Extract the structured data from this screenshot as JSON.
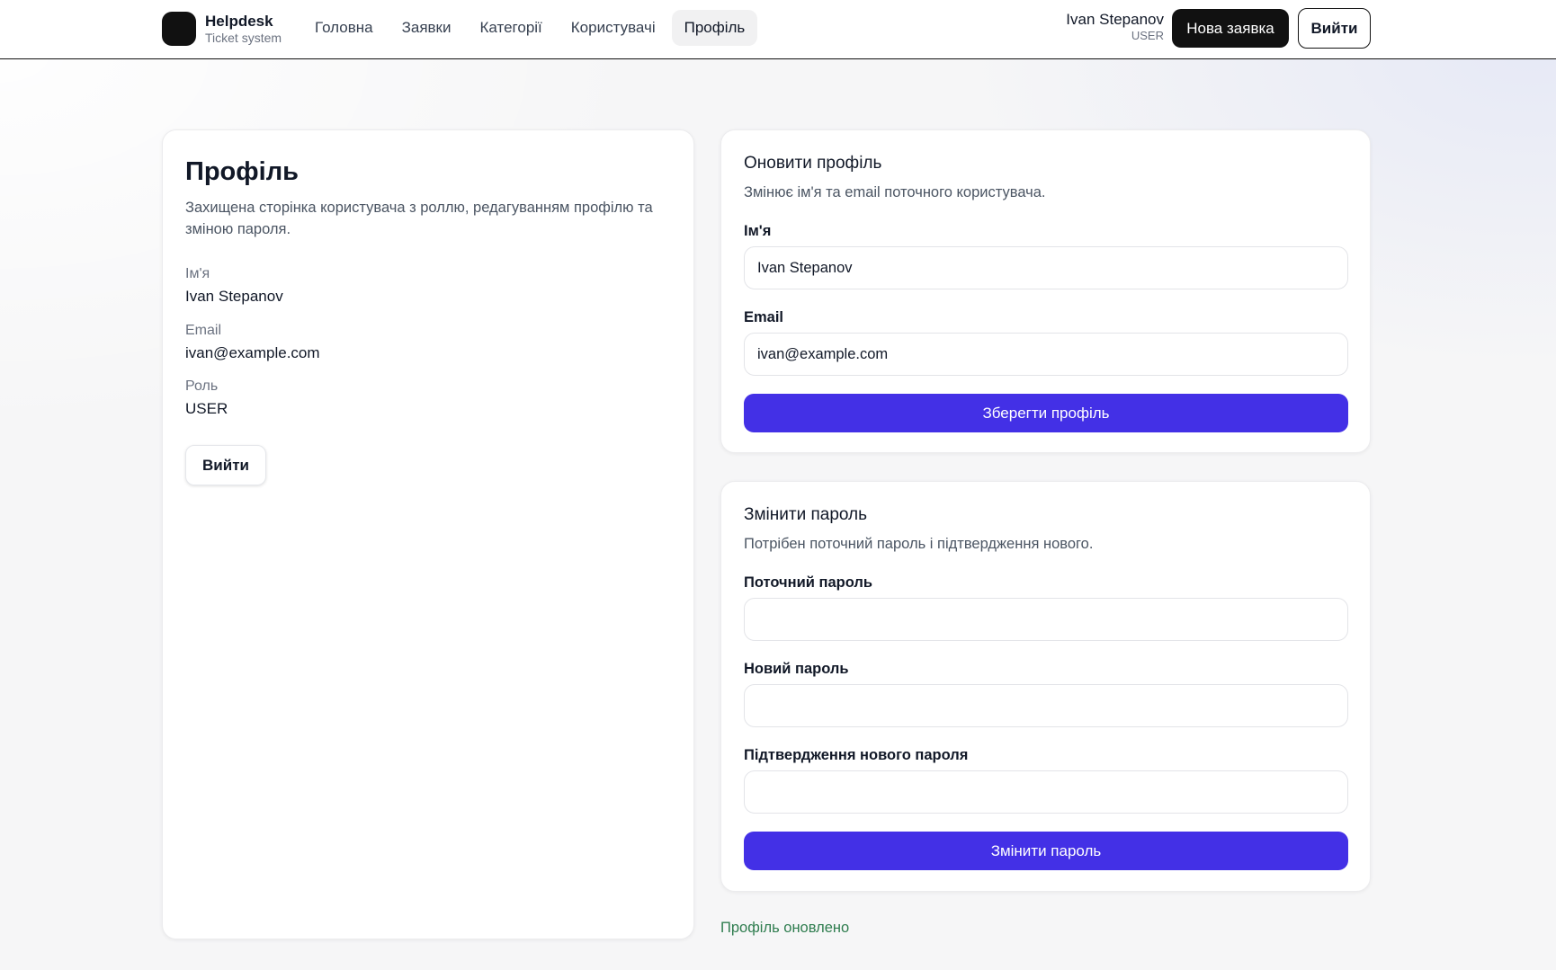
{
  "header": {
    "brand_title": "Helpdesk",
    "brand_subtitle": "Ticket system",
    "nav": [
      "Головна",
      "Заявки",
      "Категорії",
      "Користувачі",
      "Профіль"
    ],
    "active_nav": "Профіль",
    "user_name": "Ivan Stepanov",
    "user_role": "USER",
    "new_ticket_label": "Нова заявка",
    "logout_label": "Вийти"
  },
  "profile": {
    "title": "Профіль",
    "description": "Захищена сторінка користувача з роллю, редагуванням профілю та зміною пароля.",
    "name_label": "Ім'я",
    "name_value": "Ivan Stepanov",
    "email_label": "Email",
    "email_value": "ivan@example.com",
    "role_label": "Роль",
    "role_value": "USER",
    "logout_label": "Вийти"
  },
  "update_profile": {
    "title": "Оновити профіль",
    "description": "Змінює ім'я та email поточного користувача.",
    "name_label": "Ім'я",
    "name_value": "Ivan Stepanov",
    "email_label": "Email",
    "email_value": "ivan@example.com",
    "submit_label": "Зберегти профіль"
  },
  "change_password": {
    "title": "Змінити пароль",
    "description": "Потрібен поточний пароль і підтвердження нового.",
    "current_label": "Поточний пароль",
    "current_value": "",
    "new_label": "Новий пароль",
    "new_value": "",
    "confirm_label": "Підтвердження нового пароля",
    "confirm_value": "",
    "submit_label": "Змінити пароль"
  },
  "status_message": "Профіль оновлено",
  "colors": {
    "primary": "#4330e6",
    "dark": "#111111",
    "success": "#2f7d4f"
  }
}
